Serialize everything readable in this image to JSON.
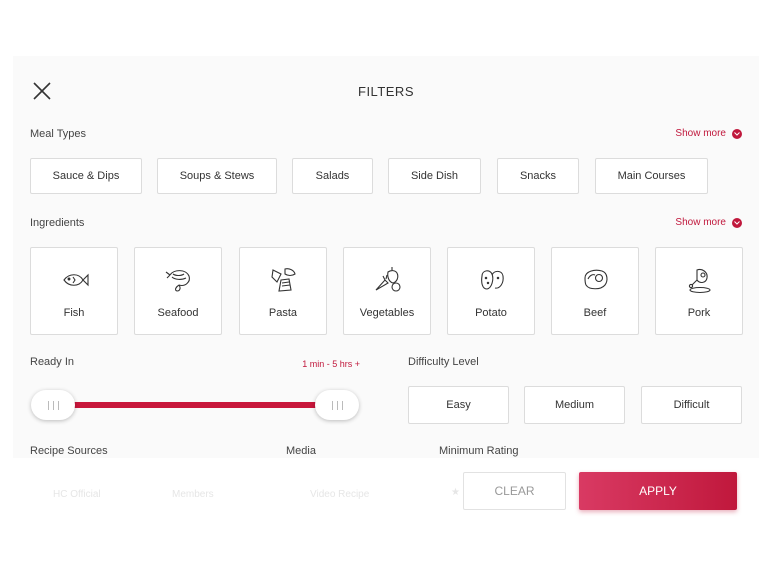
{
  "header": {
    "title": "FILTERS",
    "close_icon": "close-icon"
  },
  "meal_types": {
    "label": "Meal Types",
    "show_more": "Show more",
    "items": [
      "Sauce & Dips",
      "Soups & Stews",
      "Salads",
      "Side Dish",
      "Snacks",
      "Main Courses"
    ]
  },
  "ingredients": {
    "label": "Ingredients",
    "show_more": "Show more",
    "items": [
      {
        "label": "Fish",
        "icon": "fish-icon"
      },
      {
        "label": "Seafood",
        "icon": "shrimp-icon"
      },
      {
        "label": "Pasta",
        "icon": "pasta-icon"
      },
      {
        "label": "Vegetables",
        "icon": "vegetables-icon"
      },
      {
        "label": "Potato",
        "icon": "potato-icon"
      },
      {
        "label": "Beef",
        "icon": "steak-icon"
      },
      {
        "label": "Pork",
        "icon": "ham-icon"
      }
    ]
  },
  "ready_in": {
    "label": "Ready In",
    "range_text": "1 min - 5 hrs +"
  },
  "difficulty": {
    "label": "Difficulty Level",
    "options": [
      "Easy",
      "Medium",
      "Difficult"
    ]
  },
  "recipe_sources": {
    "label": "Recipe Sources",
    "faded_options": [
      "HC Official",
      "Members"
    ]
  },
  "media": {
    "label": "Media",
    "faded_option": "Video Recipe"
  },
  "minimum_rating": {
    "label": "Minimum Rating"
  },
  "footer": {
    "clear_label": "CLEAR",
    "apply_label": "APPLY"
  },
  "colors": {
    "accent": "#c0183c",
    "panel_bg": "#fafafa",
    "border": "#dcdcdc"
  }
}
